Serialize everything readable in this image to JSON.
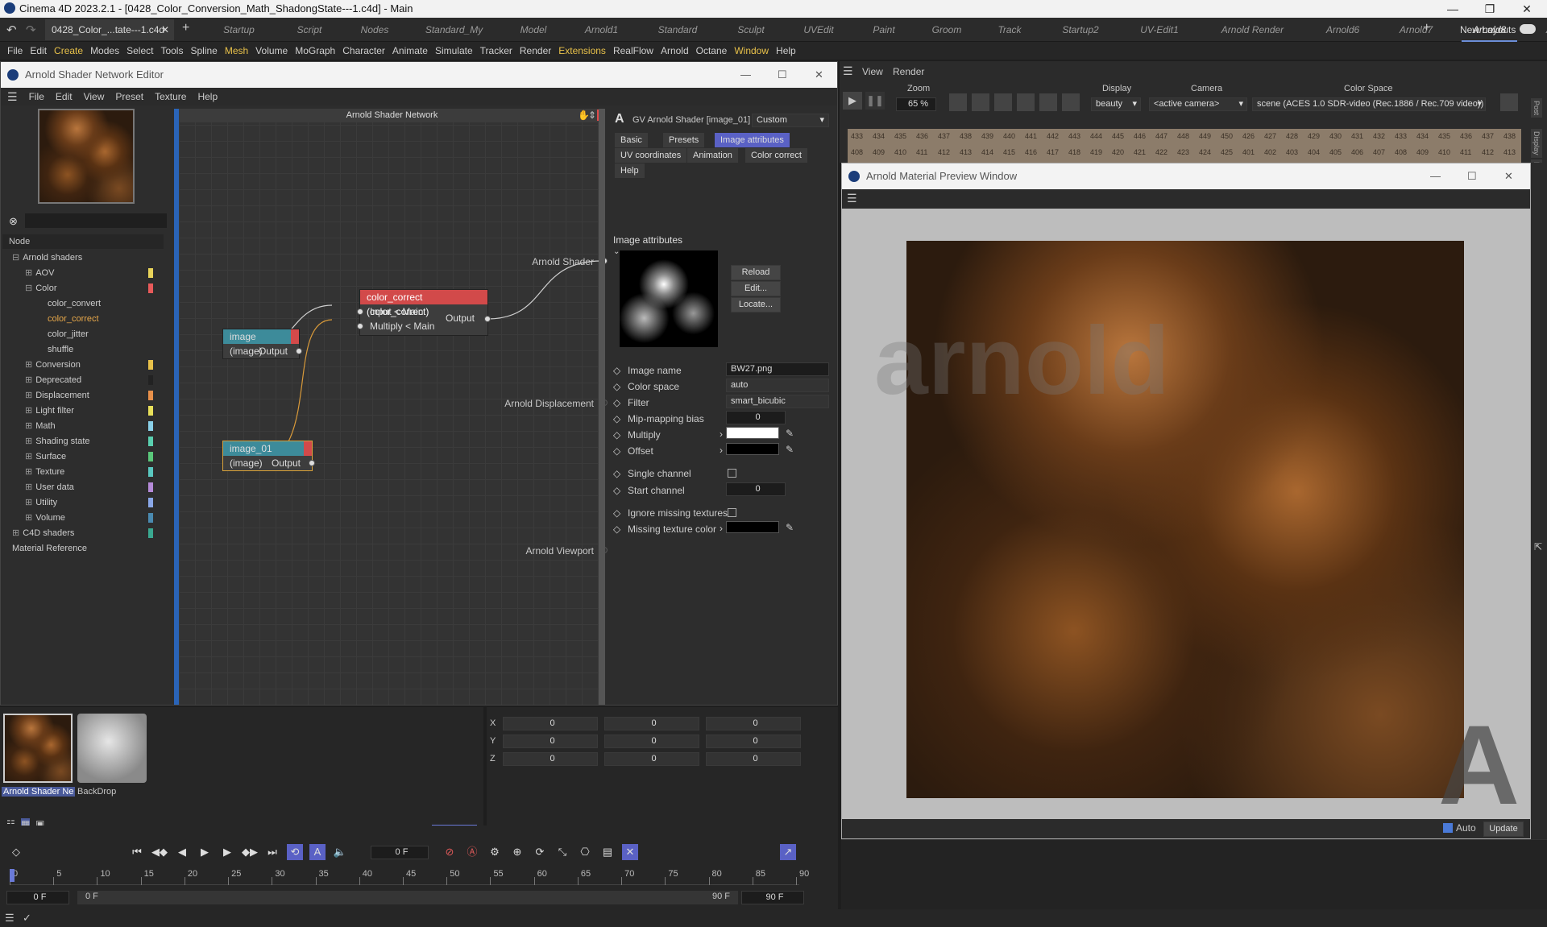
{
  "window": {
    "title": "Cinema 4D 2023.2.1 - [0428_Color_Conversion_Math_ShadongState---1.c4d] - Main",
    "minimize": "—",
    "maximize": "❐",
    "close": "✕"
  },
  "doc_tab": {
    "label": "0428_Color_...tate---1.c4d",
    "close": "✕",
    "add": "+"
  },
  "layouts": [
    "Startup",
    "Script",
    "Nodes",
    "Standard_My",
    "Model",
    "Arnold1",
    "Standard",
    "Sculpt",
    "UVEdit",
    "Paint",
    "Groom",
    "Track",
    "Startup2",
    "UV-Edit1",
    "Arnold Render",
    "Arnold6",
    "Arnold7",
    "Arnold8",
    "Arnold9"
  ],
  "active_layout": "Arnold8",
  "new_layouts": "New Layouts",
  "menu": [
    "File",
    "Edit",
    "Create",
    "Modes",
    "Select",
    "Tools",
    "Spline",
    "Mesh",
    "Volume",
    "MoGraph",
    "Character",
    "Animate",
    "Simulate",
    "Tracker",
    "Render",
    "Extensions",
    "RealFlow",
    "Arnold",
    "Octane",
    "Window",
    "Help"
  ],
  "menu_highlight": [
    "Create",
    "Mesh",
    "Extensions",
    "Window"
  ],
  "shader_editor": {
    "title": "Arnold Shader Network Editor",
    "menu": [
      "File",
      "Edit",
      "View",
      "Preset",
      "Texture",
      "Help"
    ],
    "canvas_title": "Arnold Shader Network",
    "tree_header": "Node",
    "tree": [
      {
        "label": "Arnold shaders",
        "indent": 0,
        "sign": "⊟"
      },
      {
        "label": "AOV",
        "indent": 1,
        "sign": "⊞",
        "color": "#e8d35a"
      },
      {
        "label": "Color",
        "indent": 1,
        "sign": "⊟",
        "color": "#e85a5a"
      },
      {
        "label": "color_convert",
        "indent": 2,
        "sign": ""
      },
      {
        "label": "color_correct",
        "indent": 2,
        "sign": "",
        "active": true
      },
      {
        "label": "color_jitter",
        "indent": 2,
        "sign": ""
      },
      {
        "label": "shuffle",
        "indent": 2,
        "sign": ""
      },
      {
        "label": "Conversion",
        "indent": 1,
        "sign": "⊞",
        "color": "#e8c14a"
      },
      {
        "label": "Deprecated",
        "indent": 1,
        "sign": "⊞",
        "color": "#222222"
      },
      {
        "label": "Displacement",
        "indent": 1,
        "sign": "⊞",
        "color": "#e8904a"
      },
      {
        "label": "Light filter",
        "indent": 1,
        "sign": "⊞",
        "color": "#e8e05a"
      },
      {
        "label": "Math",
        "indent": 1,
        "sign": "⊞",
        "color": "#8ad0e8"
      },
      {
        "label": "Shading state",
        "indent": 1,
        "sign": "⊞",
        "color": "#5ad0b0"
      },
      {
        "label": "Surface",
        "indent": 1,
        "sign": "⊞",
        "color": "#5ac87a"
      },
      {
        "label": "Texture",
        "indent": 1,
        "sign": "⊞",
        "color": "#5ac8c0"
      },
      {
        "label": "User data",
        "indent": 1,
        "sign": "⊞",
        "color": "#b58ad8"
      },
      {
        "label": "Utility",
        "indent": 1,
        "sign": "⊞",
        "color": "#8aa8e8"
      },
      {
        "label": "Volume",
        "indent": 1,
        "sign": "⊞",
        "color": "#4a8ab0"
      },
      {
        "label": "C4D shaders",
        "indent": 0,
        "sign": "⊞",
        "color": "#3aa890"
      },
      {
        "label": "Material Reference",
        "indent": 0,
        "sign": ""
      }
    ],
    "nodes": {
      "image": {
        "title": "image (image)",
        "port": "Output"
      },
      "image_01": {
        "title": "image_01 (image)",
        "port": "Output"
      },
      "color_correct": {
        "title": "color_correct (color_correct)",
        "in1": "Input < Main",
        "in2": "Multiply < Main",
        "out": "Output"
      }
    },
    "outputs": {
      "shader": "Arnold Shader",
      "displacement": "Arnold Displacement",
      "viewport": "Arnold Viewport"
    },
    "attr_header": {
      "title": "GV Arnold Shader [image_01]",
      "preset": "Custom"
    },
    "attr_tabs": [
      "Basic",
      "Presets",
      "Image attributes",
      "UV coordinates",
      "Animation",
      "Color correct",
      "Help"
    ],
    "active_tab": "Image attributes",
    "section": "Image attributes",
    "file_buttons": [
      "Reload",
      "Edit...",
      "Locate..."
    ],
    "fields": {
      "image_name": {
        "label": "Image name",
        "value": "BW27.png"
      },
      "color_space": {
        "label": "Color space",
        "value": "auto"
      },
      "filter": {
        "label": "Filter",
        "value": "smart_bicubic"
      },
      "mip_bias": {
        "label": "Mip-mapping bias",
        "value": "0"
      },
      "multiply": {
        "label": "Multiply",
        "color": "#ffffff"
      },
      "offset": {
        "label": "Offset",
        "color": "#000000"
      },
      "single_channel": {
        "label": "Single channel"
      },
      "start_channel": {
        "label": "Start channel",
        "value": "0"
      },
      "ignore_missing": {
        "label": "Ignore missing textures"
      },
      "missing_color": {
        "label": "Missing texture color",
        "color": "#000000"
      }
    }
  },
  "render_view": {
    "menu": [
      "View",
      "Render"
    ],
    "zoom": {
      "label": "Zoom",
      "value": "65 %"
    },
    "display": {
      "label": "Display",
      "value": "beauty"
    },
    "camera": {
      "label": "Camera",
      "value": "<active camera>"
    },
    "color_space": {
      "label": "Color Space",
      "value": "scene (ACES 1.0 SDR-video (Rec.1886 / Rec.709 video))"
    },
    "bucket_row1": [
      "433",
      "434",
      "435",
      "436",
      "437",
      "438",
      "439",
      "440",
      "441",
      "442",
      "443",
      "444",
      "445",
      "446",
      "447",
      "448",
      "449",
      "450",
      "426",
      "427",
      "428",
      "429",
      "430",
      "431",
      "432",
      "433",
      "434",
      "435",
      "436",
      "437",
      "438"
    ],
    "bucket_row2": [
      "408",
      "409",
      "410",
      "411",
      "412",
      "413",
      "414",
      "415",
      "416",
      "417",
      "418",
      "419",
      "420",
      "421",
      "422",
      "423",
      "424",
      "425",
      "401",
      "402",
      "403",
      "404",
      "405",
      "406",
      "407",
      "408",
      "409",
      "410",
      "411",
      "412",
      "413"
    ],
    "side_tabs": [
      "Post",
      "Display",
      "Pixel"
    ]
  },
  "preview_window": {
    "title": "Arnold Material Preview Window",
    "auto_label": "Auto",
    "update_label": "Update",
    "watermark": "arnold",
    "logo": "A"
  },
  "materials": [
    {
      "label": "Arnold Shader Ne"
    },
    {
      "label": "BackDrop"
    }
  ],
  "coords": {
    "axes": [
      "X",
      "Y",
      "Z"
    ],
    "values": [
      [
        "0",
        "0",
        "0"
      ],
      [
        "0",
        "0",
        "0"
      ],
      [
        "0",
        "0",
        "0"
      ]
    ]
  },
  "timeline": {
    "current_frame": "0 F",
    "ticks": [
      "0",
      "5",
      "10",
      "15",
      "20",
      "25",
      "30",
      "35",
      "40",
      "45",
      "50",
      "55",
      "60",
      "65",
      "70",
      "75",
      "80",
      "85",
      "90"
    ],
    "start": "0 F",
    "range_start": "0 F",
    "range_end": "90 F",
    "end": "90 F"
  }
}
